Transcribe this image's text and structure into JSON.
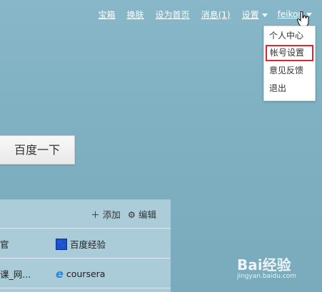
{
  "topbar": {
    "links": [
      "宝箱",
      "换肤",
      "设为首页",
      "消息(1)",
      "设置"
    ],
    "username": "feikon"
  },
  "dropdown": {
    "items": [
      "个人中心",
      "帐号设置",
      "意见反馈",
      "退出"
    ],
    "highlight_color": "#e0262c"
  },
  "search": {
    "button_label": "百度一下"
  },
  "panel": {
    "add_label": "添加",
    "edit_label": "编辑",
    "rows": [
      {
        "left": "官",
        "right": "百度经验"
      },
      {
        "left": "课_网...",
        "right": "coursera"
      }
    ]
  },
  "watermark": {
    "brand": "Bai经验",
    "url": "jingyan.baidu.com"
  }
}
